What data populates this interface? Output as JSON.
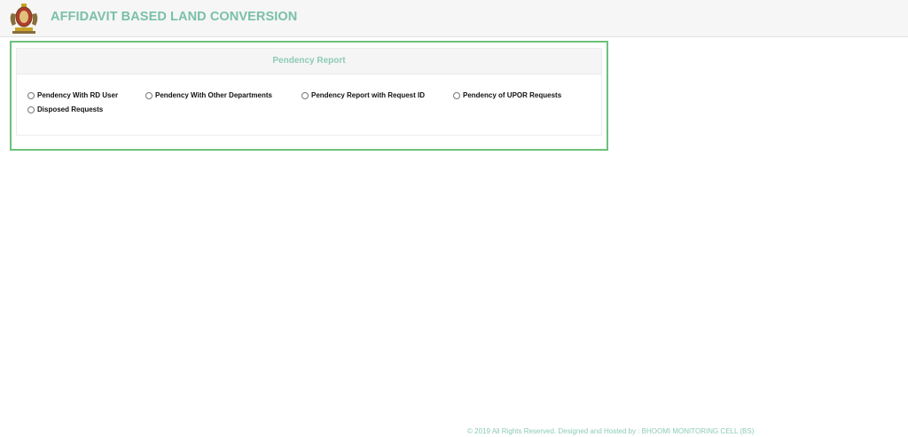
{
  "header": {
    "emblem_icon": "karnataka-emblem-icon",
    "title": "AFFIDAVIT BASED LAND CONVERSION"
  },
  "report": {
    "title": "Pendency Report",
    "options": [
      {
        "label": "Pendency With RD User",
        "selected": false
      },
      {
        "label": "Pendency With Other Departments",
        "selected": false
      },
      {
        "label": "Pendency Report with Request ID",
        "selected": false
      },
      {
        "label": "Pendency of UPOR Requests",
        "selected": false
      },
      {
        "label": "Disposed Requests",
        "selected": false
      }
    ]
  },
  "footer": {
    "text": "© 2019 All Rights Reserved. Designed and Hosted by : BHOOMI MONITORING CELL (BS)"
  },
  "colors": {
    "accent_text": "#7ac0a6",
    "panel_border": "#6cc17a",
    "header_bg": "#f6f6f6"
  }
}
